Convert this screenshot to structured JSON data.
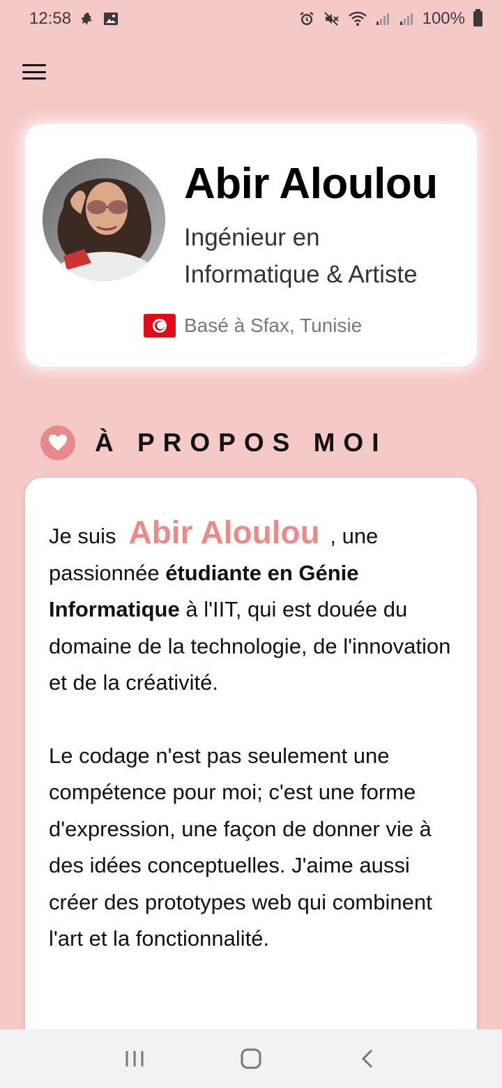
{
  "status_bar": {
    "time": "12:58",
    "battery": "100%"
  },
  "profile": {
    "name": "Abir Aloulou",
    "role_line1": "Ingénieur en",
    "role_line2": "Informatique & Artiste",
    "location": "Basé à Sfax, Tunisie"
  },
  "about": {
    "section_title": "À PROPOS MOI",
    "p1_prefix": "Je suis",
    "p1_name": "Abir Aloulou",
    "p1_after_name": " , une passionnée ",
    "p1_bold": "étudiante en Génie Informatique",
    "p1_rest": " à l'IIT, qui est douée du domaine de la technologie, de l'innovation et de la créativité.",
    "p2": "Le codage n'est pas seulement une compétence pour moi; c'est une forme d'expression, une façon de donner vie à des idées conceptuelles. J'aime aussi créer des prototypes web qui combinent l'art et la fonctionnalité."
  },
  "colors": {
    "background": "#f6c9c9",
    "accent": "#ec8a8a",
    "flag_red": "#e30a17"
  },
  "icons": {
    "menu": "hamburger-menu-icon",
    "heart": "heart-icon",
    "flag": "tunisia-flag-icon"
  }
}
